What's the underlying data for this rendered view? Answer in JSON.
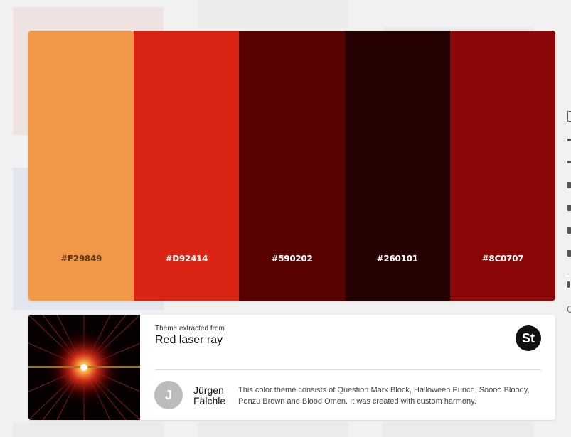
{
  "palette": {
    "swatches": [
      {
        "hex_label": "#F29849",
        "color": "#F29849",
        "label_color": "#5a3a1a"
      },
      {
        "hex_label": "#D92414",
        "color": "#D92414",
        "label_color": "#ffffff"
      },
      {
        "hex_label": "#590202",
        "color": "#590202",
        "label_color": "#ffffff"
      },
      {
        "hex_label": "#260101",
        "color": "#260101",
        "label_color": "#ffffff"
      },
      {
        "hex_label": "#8C0707",
        "color": "#8C0707",
        "label_color": "#ffffff"
      }
    ]
  },
  "theme_info": {
    "source_caption": "Theme extracted from",
    "source_title": "Red laser ray",
    "stock_badge": "St",
    "author": {
      "initial": "J",
      "name_line1": "Jürgen",
      "name_line2": "Fälchle"
    },
    "description": "This color theme consists of Question Mark Block, Halloween Punch, Soooo Bloody, Ponzu Brown and Blood Omen. It was created with custom harmony."
  }
}
